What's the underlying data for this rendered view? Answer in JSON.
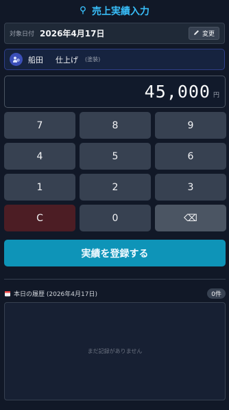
{
  "header": {
    "title": "売上実績入力",
    "icon": "pin-icon"
  },
  "date": {
    "label": "対象日付",
    "value": "2026年4月17日",
    "change_label": "変更"
  },
  "staff": {
    "name": "船田",
    "department": "仕上げ",
    "sub": "(塗装)"
  },
  "amount": {
    "value": "45,000",
    "unit": "円"
  },
  "keypad": {
    "keys": [
      "7",
      "8",
      "9",
      "4",
      "5",
      "6",
      "1",
      "2",
      "3",
      "C",
      "0",
      "⌫"
    ]
  },
  "submit_label": "実績を登録する",
  "history": {
    "title": "本日の履歴 (2026年4月17日)",
    "count": "0件",
    "empty_message": "まだ記録がありません"
  },
  "colors": {
    "accent": "#0e94b8",
    "title": "#38bdf8",
    "clear_key": "#4c1d24"
  }
}
